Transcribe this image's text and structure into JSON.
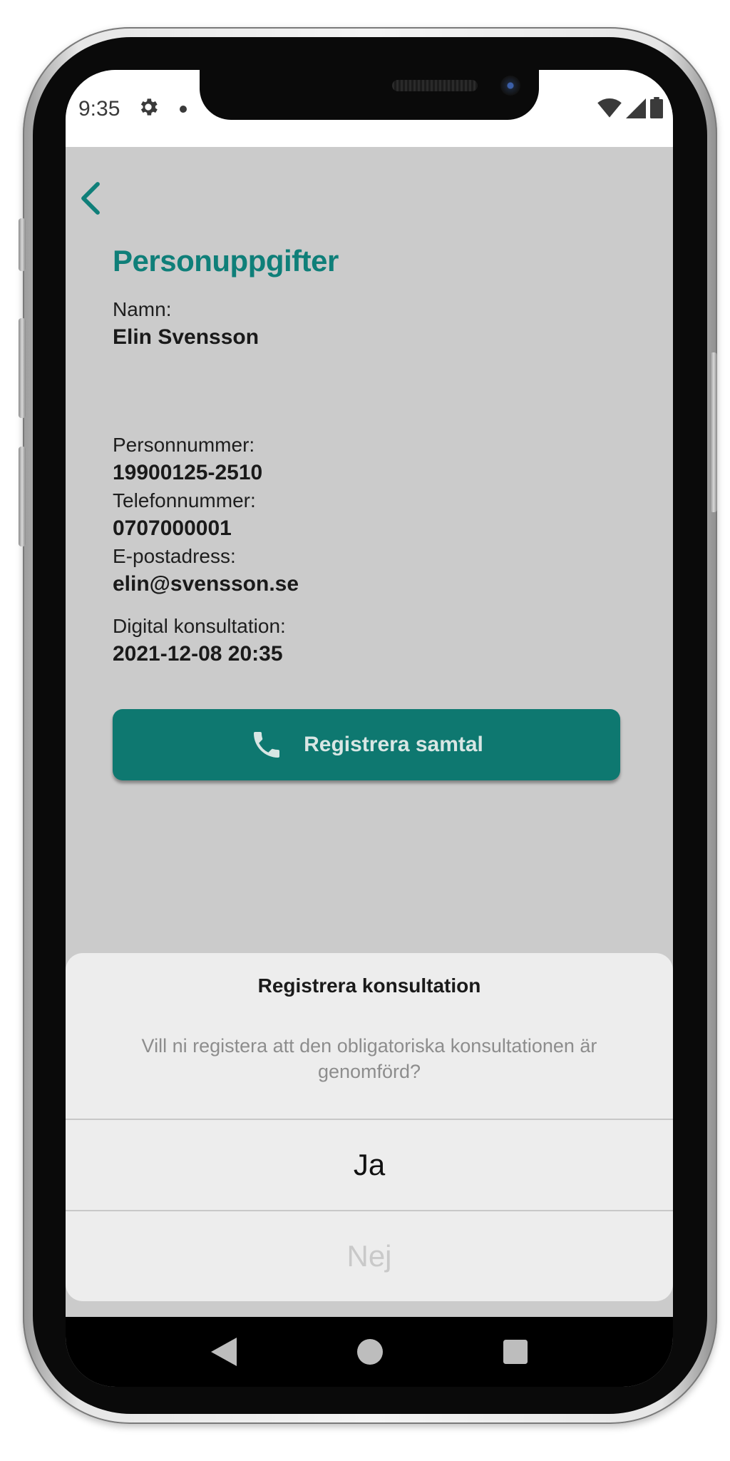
{
  "status_bar": {
    "time": "9:35",
    "icons": [
      "gear-icon",
      "notification-dot-icon",
      "wifi-icon",
      "signal-icon",
      "battery-icon"
    ]
  },
  "header": {
    "back_icon": "chevron-left-icon",
    "title": "Personuppgifter"
  },
  "details": {
    "name_label": "Namn:",
    "name_value": "Elin Svensson",
    "personal_number_label": "Personnummer:",
    "personal_number_value": "19900125-2510",
    "phone_label": "Telefonnummer:",
    "phone_value": "0707000001",
    "email_label": "E-postadress:",
    "email_value": "elin@svensson.se",
    "consultation_label": "Digital konsultation:",
    "consultation_value": "2021-12-08 20:35"
  },
  "call_button": {
    "icon": "phone-icon",
    "label": "Registrera samtal"
  },
  "dialog": {
    "title": "Registrera konsultation",
    "message": "Vill ni registera att den obligatoriska konsultationen är genomförd?",
    "yes_label": "Ja",
    "no_label": "Nej"
  },
  "nav_bar": {
    "icons": [
      "back-triangle-icon",
      "home-circle-icon",
      "recents-square-icon"
    ]
  },
  "colors": {
    "accent": "#0f7f79",
    "button": "#0e7870",
    "overlay_background": "#cbcbcb",
    "dialog_background": "#ededed"
  }
}
